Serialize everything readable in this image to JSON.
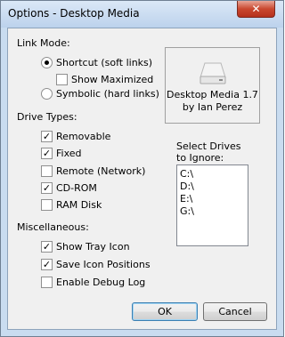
{
  "window": {
    "title": "Options - Desktop Media",
    "close_glyph": "✕"
  },
  "link_mode": {
    "heading": "Link Mode:",
    "shortcut_label": "Shortcut (soft links)",
    "shortcut_selected": true,
    "show_maximized_label": "Show Maximized",
    "show_maximized_checked": false,
    "symbolic_label": "Symbolic (hard links)",
    "symbolic_selected": false
  },
  "drive_types": {
    "heading": "Drive Types:",
    "items": [
      {
        "label": "Removable",
        "checked": true
      },
      {
        "label": "Fixed",
        "checked": true
      },
      {
        "label": "Remote (Network)",
        "checked": false
      },
      {
        "label": "CD-ROM",
        "checked": true
      },
      {
        "label": "RAM Disk",
        "checked": false
      }
    ]
  },
  "misc": {
    "heading": "Miscellaneous:",
    "items": [
      {
        "label": "Show Tray Icon",
        "checked": true
      },
      {
        "label": "Save Icon Positions",
        "checked": true
      },
      {
        "label": "Enable Debug Log",
        "checked": false
      }
    ]
  },
  "about": {
    "product": "Desktop Media 1.7",
    "author": "by Ian Perez",
    "icon": "drive-icon"
  },
  "ignore": {
    "label_line1": "Select Drives",
    "label_line2": "to Ignore:",
    "drives": [
      "C:\\",
      "D:\\",
      "E:\\",
      "G:\\"
    ]
  },
  "buttons": {
    "ok": "OK",
    "cancel": "Cancel"
  },
  "glyphs": {
    "check": "✓"
  }
}
